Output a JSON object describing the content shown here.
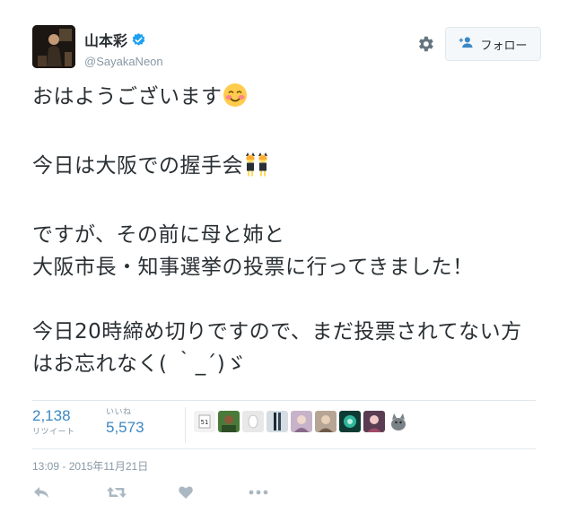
{
  "user": {
    "display_name": "山本彩",
    "handle": "@SayakaNeon"
  },
  "follow_button": {
    "label": "フォロー"
  },
  "tweet": {
    "lines": [
      "おはようございます",
      "今日は大阪での握手会",
      "ですが、その前に母と姉と\n大阪市長・知事選挙の投票に行ってきました！",
      "今日20時締め切りですので、まだ投票されてない方はお忘れなく( ｀_´)ゞ"
    ]
  },
  "stats": {
    "retweets_count": "2,138",
    "retweets_label": "リツイート",
    "likes_count": "5,573",
    "likes_label": "いいね"
  },
  "timestamp": "13:09 - 2015年11月21日",
  "icons": {
    "verified": "verified-badge-icon",
    "gear": "gear-icon",
    "follow": "person-add-icon",
    "reply": "reply-icon",
    "retweet": "retweet-icon",
    "like": "heart-icon",
    "more": "more-dots-icon"
  },
  "colors": {
    "accent": "#3b88c3",
    "muted": "#8899a6",
    "text": "#292f33",
    "border": "#e1e8ed"
  }
}
